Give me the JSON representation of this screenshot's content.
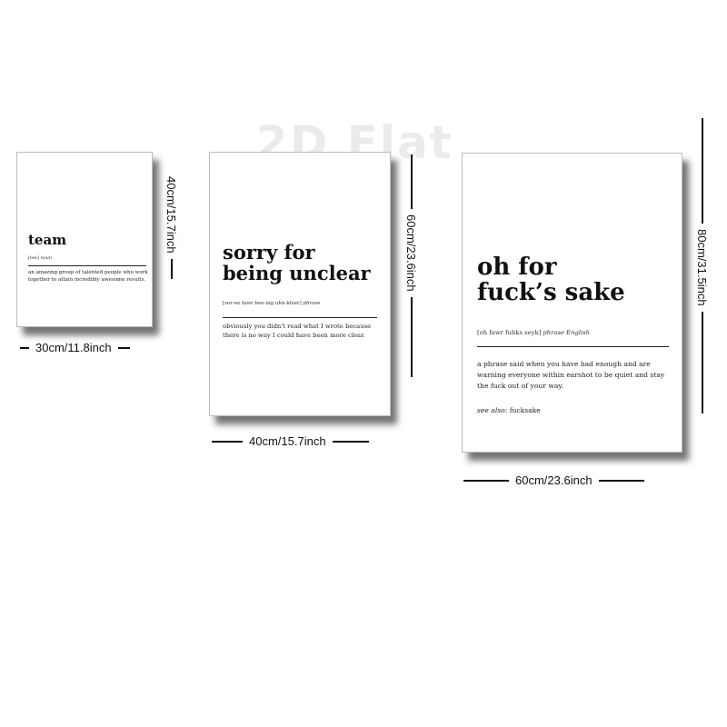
{
  "watermark": "2D Flat",
  "posters": [
    {
      "word": "team",
      "pronunciation": "[tee]",
      "part_of_speech": "noun",
      "definition": "an amazing group of talented people who work together to attain incredibly awesome results.",
      "width_label": "30cm/11.8inch",
      "height_label": "40cm/15.7inch"
    },
    {
      "word_line1": "sorry for",
      "word_line2": "being unclear",
      "pronunciation": "[sor-ee fawr bee-ing uhn-kleer]",
      "part_of_speech": "phrase",
      "definition": "obviously you didn't read what I wrote because there is no way I could have been more clear.",
      "width_label": "40cm/15.7inch",
      "height_label": "60cm/23.6inch"
    },
    {
      "word_line1": "oh for",
      "word_line2": "fuck’s sake",
      "pronunciation": "[oh fawr fuhks seyk]",
      "part_of_speech": "phrase  English",
      "definition": "a phrase said when you have had enough and are warning everyone within earshot to be quiet and stay the fuck out of your way.",
      "see_also_label": "see also",
      "see_also_value": ": fucksake",
      "width_label": "60cm/23.6inch",
      "height_label": "80cm/31.5inch"
    }
  ]
}
